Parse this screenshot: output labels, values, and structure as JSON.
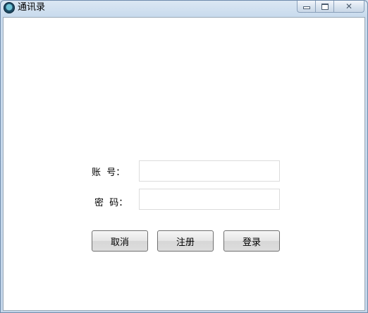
{
  "window": {
    "title": "通讯录",
    "controls": {
      "minimize": "minimize-icon",
      "maximize": "maximize-icon",
      "close": "close-icon"
    }
  },
  "form": {
    "account_label": "账  号：",
    "account_value": "",
    "password_label": "密  码：",
    "password_value": ""
  },
  "buttons": {
    "cancel": "取消",
    "register": "注册",
    "login": "登录"
  },
  "colors": {
    "titlebar": "#c9dbed",
    "client_bg": "#ffffff",
    "input_border": "#dcdcdc",
    "button_border": "#707070"
  }
}
